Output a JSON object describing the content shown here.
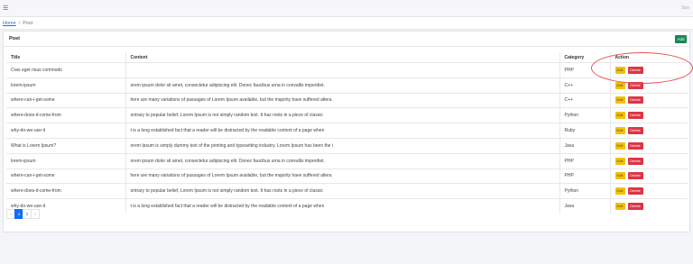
{
  "topbar": {
    "menu_icon": "hamburger-icon",
    "user_text": "Sun"
  },
  "breadcrumb": {
    "home": "Home",
    "separator": "/",
    "current": "Post"
  },
  "card": {
    "title": "Post",
    "add_label": "Add"
  },
  "table": {
    "headers": {
      "title": "Title",
      "content": "Content",
      "category": "Category",
      "action": "Action"
    },
    "rows": [
      {
        "title": "Cras eget risus commodo",
        "content": "",
        "category": "PHP"
      },
      {
        "title": "lorem-ipsum",
        "content": "orem ipsum dolor sit amet, consectetur adipiscing elit. Donec faucibus urna in convallis imperdiet.",
        "category": "C++"
      },
      {
        "title": "where-can-i-get-some",
        "content": "here are many variations of passages of Lorem Ipsum available, but the majority have suffered altera",
        "category": "C++"
      },
      {
        "title": "where-does-it-come-from",
        "content": "ontrary to popular belief, Lorem Ipsum is not simply random text. It has roots in a piece of classic",
        "category": "Python"
      },
      {
        "title": "why-do-we-use-it",
        "content": "t is a long established fact that a reader will be distracted by the readable content of a page when",
        "category": "Ruby"
      },
      {
        "title": "What is Lorem Ipsum?",
        "content": "orem Ipsum is simply dummy text of the printing and typesetting industry. Lorem Ipsum has been the i",
        "category": "Java"
      },
      {
        "title": "lorem-ipsum",
        "content": "orem ipsum dolor sit amet, consectetur adipiscing elit. Donec faucibus urna in convallis imperdiet.",
        "category": "PHP"
      },
      {
        "title": "where-can-i-get-some",
        "content": "here are many variations of passages of Lorem Ipsum available, but the majority have suffered altera",
        "category": "PHP"
      },
      {
        "title": "where-does-it-come-from",
        "content": "ontrary to popular belief, Lorem Ipsum is not simply random text. It has roots in a piece of classic",
        "category": "Python"
      },
      {
        "title": "why-do-we-use-it",
        "content": "t is a long established fact that a reader will be distracted by the readable content of a page when",
        "category": "Java"
      }
    ],
    "edit_label": "Edit",
    "delete_label": "Delete"
  },
  "pagination": {
    "prev": "‹",
    "pages": [
      "1",
      "2"
    ],
    "next": "›",
    "active_page": "1"
  },
  "colors": {
    "edit": "#f2c10f",
    "delete": "#dc3545",
    "add": "#198754",
    "active_page": "#0d6efd",
    "annotation": "#e25050"
  }
}
